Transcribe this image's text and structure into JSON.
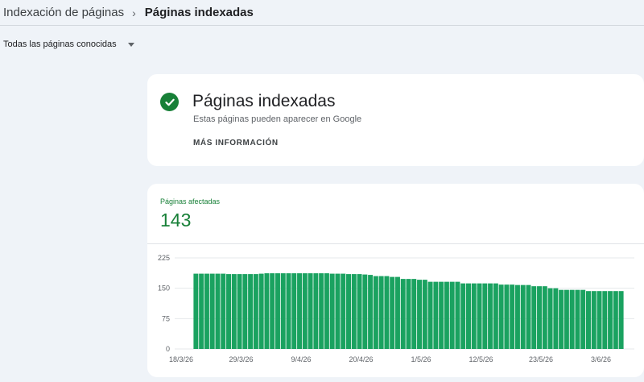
{
  "breadcrumb": {
    "parent": "Indexación de páginas",
    "separator_icon": "chevron-right-icon",
    "current": "Páginas indexadas"
  },
  "filter": {
    "selected": "Todas las páginas conocidas",
    "icon": "caret-down-icon"
  },
  "status": {
    "icon": "check-circle-icon",
    "title": "Páginas indexadas",
    "description": "Estas páginas pueden aparecer en Google",
    "more_link": "MÁS INFORMACIÓN"
  },
  "metric": {
    "label": "Páginas afectadas",
    "value": "143"
  },
  "colors": {
    "accent": "#188038",
    "bar": "#1aa260",
    "background": "#eff3f8"
  },
  "chart_data": {
    "type": "bar",
    "ylim": [
      0,
      225
    ],
    "y_ticks": [
      "225",
      "150",
      "75",
      "0"
    ],
    "x_ticks": [
      "18/3/26",
      "29/3/26",
      "9/4/26",
      "20/4/26",
      "1/5/26",
      "12/5/26",
      "23/5/26",
      "3/6/26"
    ],
    "x_tick_positions": [
      0,
      11,
      22,
      33,
      44,
      55,
      66,
      77
    ],
    "values": [
      186,
      186,
      186,
      186,
      186,
      186,
      185,
      185,
      185,
      185,
      185,
      185,
      186,
      187,
      187,
      187,
      187,
      187,
      187,
      187,
      187,
      187,
      187,
      187,
      187,
      186,
      186,
      186,
      185,
      185,
      185,
      184,
      183,
      180,
      180,
      180,
      178,
      178,
      173,
      173,
      173,
      171,
      171,
      166,
      166,
      166,
      166,
      166,
      166,
      162,
      162,
      162,
      162,
      162,
      162,
      162,
      159,
      159,
      159,
      158,
      158,
      158,
      155,
      155,
      155,
      150,
      150,
      146,
      146,
      146,
      146,
      146,
      143,
      143,
      143,
      143,
      143,
      143,
      143
    ],
    "grid": true,
    "xlabel": "",
    "ylabel": ""
  }
}
